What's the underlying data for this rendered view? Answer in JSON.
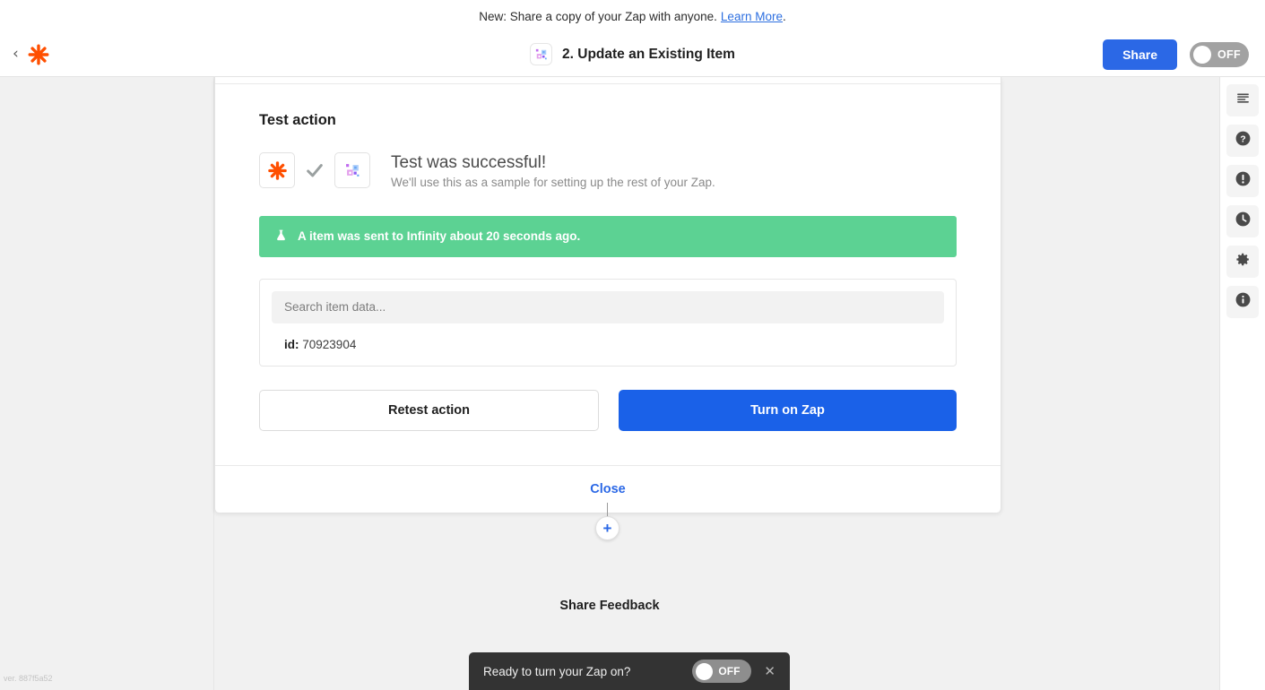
{
  "announcement": {
    "text": "New: Share a copy of your Zap with anyone.",
    "link_label": "Learn More",
    "trailing": "."
  },
  "header": {
    "back_icon": "chevron-left-icon",
    "brand_icon": "zapier-logo-icon",
    "app_icon": "infinity-app-icon",
    "title": "2. Update an Existing Item",
    "share_label": "Share",
    "zap_toggle": {
      "state_label": "OFF",
      "enabled": false
    }
  },
  "modal": {
    "section_title": "Test action",
    "result": {
      "trigger_icon": "zapier-logo-icon",
      "status_icon": "checkmark-icon",
      "action_icon": "infinity-app-icon",
      "headline": "Test was successful!",
      "subtext": "We'll use this as a sample for setting up the rest of your Zap."
    },
    "alert": {
      "icon": "flask-icon",
      "message": "A item was sent to Infinity about 20 seconds ago.",
      "color": "#5cd293"
    },
    "data_panel": {
      "search_placeholder": "Search item data...",
      "fields": [
        {
          "key": "id:",
          "value": "70923904"
        }
      ]
    },
    "buttons": {
      "retest_label": "Retest action",
      "turn_on_label": "Turn on Zap",
      "turn_on_color": "#1a61e8"
    },
    "footer": {
      "close_label": "Close"
    }
  },
  "canvas": {
    "add_step_icon": "plus-icon",
    "share_feedback_label": "Share Feedback"
  },
  "toast": {
    "message": "Ready to turn your Zap on?",
    "toggle": {
      "state_label": "OFF",
      "enabled": false
    },
    "close_icon": "close-icon"
  },
  "rail": {
    "items": [
      {
        "icon": "notes-icon",
        "name": "notes"
      },
      {
        "icon": "help-icon",
        "name": "help"
      },
      {
        "icon": "alert-icon",
        "name": "alerts"
      },
      {
        "icon": "history-icon",
        "name": "history"
      },
      {
        "icon": "settings-icon",
        "name": "settings"
      },
      {
        "icon": "info-icon",
        "name": "info"
      }
    ]
  },
  "footer": {
    "version": "ver. 887f5a52"
  }
}
